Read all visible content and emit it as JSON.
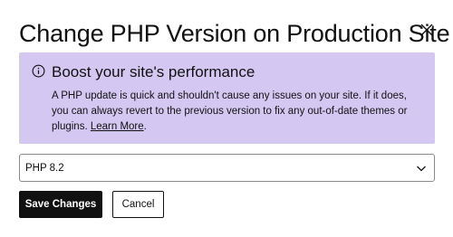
{
  "dialog": {
    "title": "Change PHP Version on Production Site",
    "close_icon": "close-icon"
  },
  "alert": {
    "icon": "info-icon",
    "heading": "Boost your site's performance",
    "body_text": "A PHP update is quick and shouldn't cause any issues on your site. If it does, you can always revert to the previous version to fix any out-of-date themes or plugins. ",
    "link_label": "Learn More",
    "body_end": ".",
    "background_color": "#d4c8f2"
  },
  "php_select": {
    "selected_value": "PHP 8.2",
    "icon": "chevron-down-icon"
  },
  "actions": {
    "save_label": "Save Changes",
    "cancel_label": "Cancel"
  }
}
